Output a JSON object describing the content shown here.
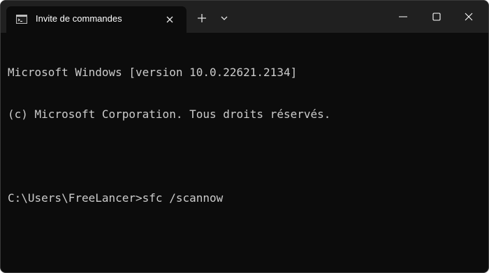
{
  "window": {
    "tab_title": "Invite de commandes",
    "icons": {
      "tab": "terminal-icon",
      "tab_close": "close-icon",
      "new_tab": "plus-icon",
      "dropdown": "chevron-down-icon",
      "minimize": "minimize-icon",
      "maximize": "maximize-icon",
      "close": "close-icon"
    },
    "colors": {
      "background": "#0c0c0c",
      "titlebar": "#202020",
      "text": "#cccccc",
      "title_text": "#ffffff"
    }
  },
  "console": {
    "lines": [
      "Microsoft Windows [version 10.0.22621.2134]",
      "(c) Microsoft Corporation. Tous droits réservés.",
      "",
      "C:\\Users\\FreeLancer>sfc /scannow"
    ]
  }
}
